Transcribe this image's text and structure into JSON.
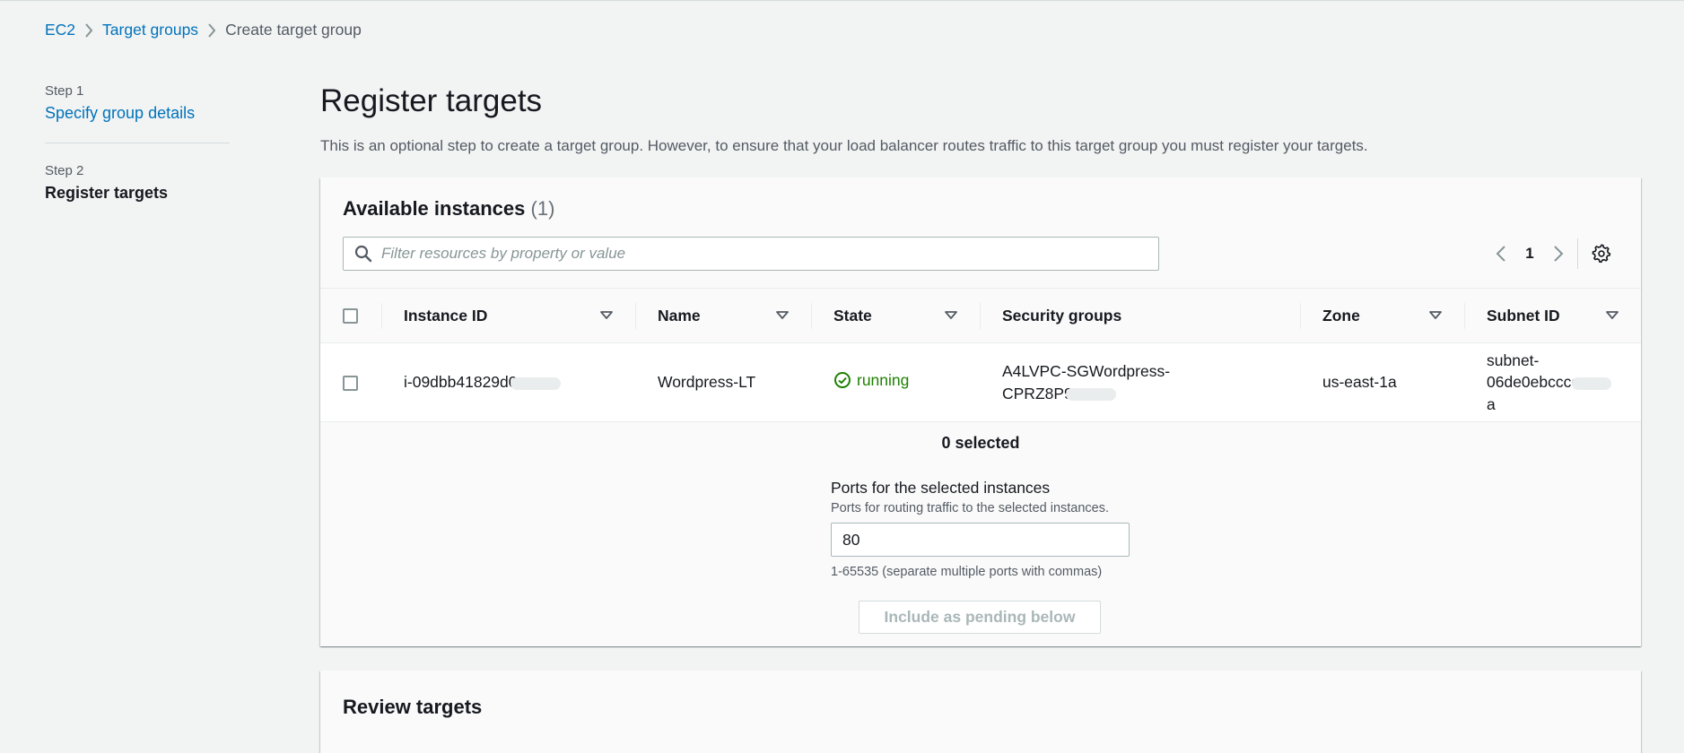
{
  "breadcrumb": {
    "items": [
      {
        "label": "EC2"
      },
      {
        "label": "Target groups"
      },
      {
        "label": "Create target group"
      }
    ]
  },
  "steps": [
    {
      "label": "Step 1",
      "title": "Specify group details"
    },
    {
      "label": "Step 2",
      "title": "Register targets"
    }
  ],
  "page": {
    "title": "Register targets",
    "description": "This is an optional step to create a target group. However, to ensure that your load balancer routes traffic to this target group you must register your targets."
  },
  "available": {
    "title": "Available instances",
    "count": "(1)",
    "filter_placeholder": "Filter resources by property or value",
    "page": "1",
    "columns": [
      "Instance ID",
      "Name",
      "State",
      "Security groups",
      "Zone",
      "Subnet ID"
    ],
    "rows": [
      {
        "instance_id": "i-09dbb41829d0",
        "name": "Wordpress-LT",
        "state": "running",
        "security_groups_line1": "A4LVPC-SGWordpress-",
        "security_groups_line2": "CPRZ8P9",
        "zone": "us-east-1a",
        "subnet_line1": "subnet-",
        "subnet_line2": "06de0ebcccc",
        "subnet_line3": "a"
      }
    ],
    "selected_text": "0 selected",
    "ports_label": "Ports for the selected instances",
    "ports_description": "Ports for routing traffic to the selected instances.",
    "ports_value": "80",
    "ports_hint": "1-65535 (separate multiple ports with commas)",
    "pending_button": "Include as pending below"
  },
  "review": {
    "title": "Review targets"
  },
  "colors": {
    "link": "#0073bb",
    "running": "#1d8102",
    "background": "#f2f3f3"
  }
}
